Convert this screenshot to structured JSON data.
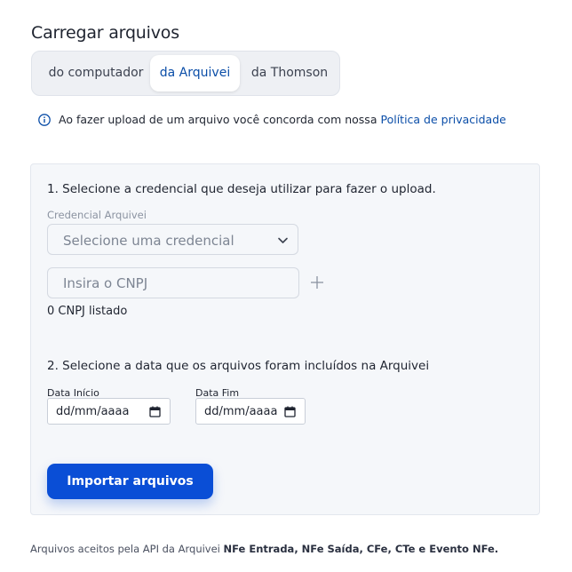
{
  "page": {
    "title": "Carregar arquivos"
  },
  "tabs": [
    {
      "label": "do computador",
      "active": false
    },
    {
      "label": "da Arquivei",
      "active": true
    },
    {
      "label": "da Thomson",
      "active": false
    }
  ],
  "notice": {
    "icon": "info-icon",
    "text": "Ao fazer upload de um arquivo você concorda com nossa",
    "link": "Política de privacidade"
  },
  "step1": {
    "heading": "1. Selecione a credencial que deseja utilizar para fazer o upload.",
    "credential_label": "Credencial Arquivei",
    "credential_select": {
      "value": "Selecione uma credencial"
    },
    "cnpj_input": {
      "placeholder": "Insira o CNPJ",
      "value": ""
    },
    "listed_count": "0 CNPJ listado"
  },
  "step2": {
    "heading": "2. Selecione a data que os arquivos foram incluídos na Arquivei",
    "start": {
      "label": "Data Início",
      "value": "dd/mm/aaaa"
    },
    "end": {
      "label": "Data Fim",
      "value": "dd/mm/aaaa"
    }
  },
  "import_button": "Importar arquivos",
  "footer": {
    "prefix": "Arquivos aceitos pela API da Arquivei",
    "types": "NFe Entrada, NFe Saída, CFe, CTe e Evento NFe."
  },
  "colors": {
    "accent": "#0a4ed6",
    "link": "#0b4ea8",
    "panel": "#f5f7fa"
  }
}
